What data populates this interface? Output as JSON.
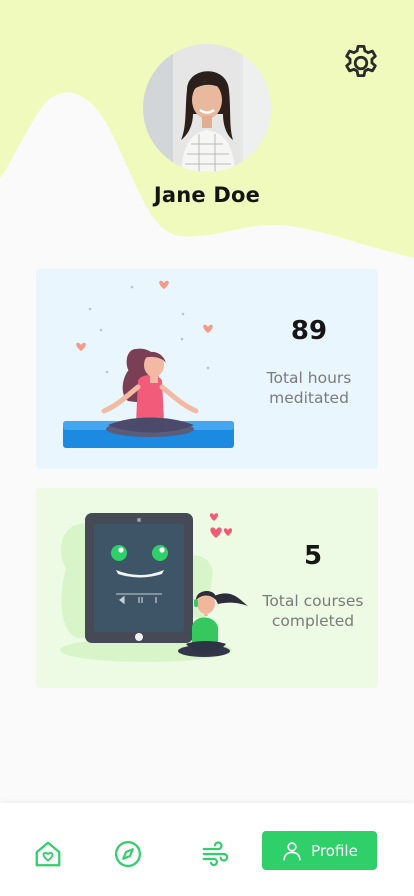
{
  "profile": {
    "name": "Jane Doe"
  },
  "stats": {
    "hours": {
      "value": "89",
      "label": "Total hours meditated"
    },
    "courses": {
      "value": "5",
      "label": "Total courses completed"
    }
  },
  "nav": {
    "items": [
      {
        "icon": "home-icon"
      },
      {
        "icon": "compass-icon"
      },
      {
        "icon": "wind-icon"
      },
      {
        "icon": "user-icon",
        "label": "Profile",
        "active": true
      }
    ]
  },
  "colors": {
    "accent": "#2fcf6a",
    "header_blob": "#f1fabd",
    "hours_card": "#eaf6fd",
    "courses_card": "#edfbe4"
  }
}
